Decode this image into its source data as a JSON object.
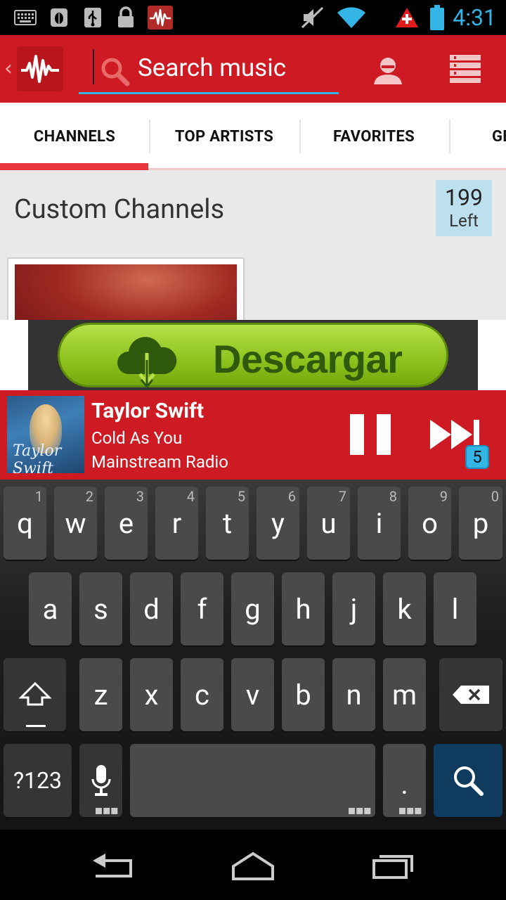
{
  "status_bar": {
    "time": "4:31",
    "icons": [
      "keyboard-icon",
      "bug-icon",
      "usb-icon",
      "lock-icon",
      "app-notification-icon",
      "vibrate-off-icon",
      "wifi-icon",
      "alert-icon",
      "battery-icon"
    ]
  },
  "app_bar": {
    "back_glyph": "‹",
    "search_placeholder": "Search music",
    "icons": [
      "app-logo-icon",
      "search-icon",
      "profile-icon",
      "menu-icon"
    ],
    "accent_color": "#ce1a22"
  },
  "tabs": [
    {
      "label": "CHANNELS",
      "active": true
    },
    {
      "label": "TOP ARTISTS",
      "active": false
    },
    {
      "label": "FAVORITES",
      "active": false
    },
    {
      "label": "GENRES",
      "active": false
    }
  ],
  "content": {
    "section_title": "Custom Channels",
    "counter": {
      "value": "199",
      "label": "Left"
    }
  },
  "ad": {
    "label": "Descargar"
  },
  "now_playing": {
    "artist": "Taylor Swift",
    "title": "Cold As You",
    "station": "Mainstream Radio",
    "album_script": "Taylor Swift",
    "skips_left": "5"
  },
  "keyboard": {
    "row1": [
      {
        "char": "q",
        "hint": "1"
      },
      {
        "char": "w",
        "hint": "2"
      },
      {
        "char": "e",
        "hint": "3"
      },
      {
        "char": "r",
        "hint": "4"
      },
      {
        "char": "t",
        "hint": "5"
      },
      {
        "char": "y",
        "hint": "6"
      },
      {
        "char": "u",
        "hint": "7"
      },
      {
        "char": "i",
        "hint": "8"
      },
      {
        "char": "o",
        "hint": "9"
      },
      {
        "char": "p",
        "hint": "0"
      }
    ],
    "row2": [
      "a",
      "s",
      "d",
      "f",
      "g",
      "h",
      "j",
      "k",
      "l"
    ],
    "row3": [
      "z",
      "x",
      "c",
      "v",
      "b",
      "n",
      "m"
    ],
    "symbols_label": "?123",
    "period_label": ".",
    "icons": [
      "shift-icon",
      "backspace-icon",
      "microphone-icon",
      "search-icon"
    ]
  },
  "nav_bar": {
    "icons": [
      "back-icon",
      "home-icon",
      "recent-apps-icon"
    ]
  }
}
